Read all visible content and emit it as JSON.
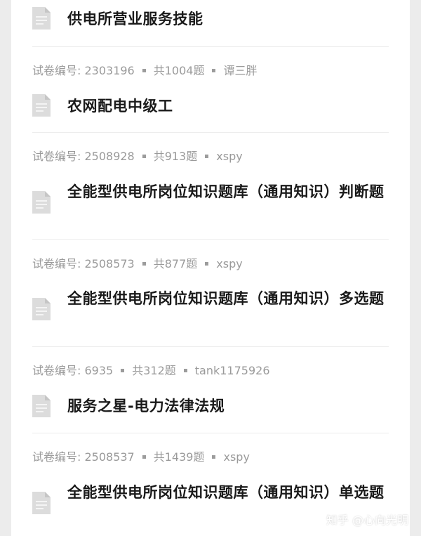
{
  "items": [
    {
      "meta": null,
      "title": "供电所营业服务技能"
    },
    {
      "meta": {
        "id": "试卷编号: 2303196",
        "count": "共1004题",
        "author": "谭三胖"
      },
      "title": "农网配电中级工"
    },
    {
      "meta": {
        "id": "试卷编号: 2508928",
        "count": "共913题",
        "author": "xspy"
      },
      "title": "全能型供电所岗位知识题库（通用知识）判断题"
    },
    {
      "meta": {
        "id": "试卷编号: 2508573",
        "count": "共877题",
        "author": "xspy"
      },
      "title": "全能型供电所岗位知识题库（通用知识）多选题"
    },
    {
      "meta": {
        "id": "试卷编号: 6935",
        "count": "共312题",
        "author": "tank1175926"
      },
      "title": "服务之星-电力法律法规"
    },
    {
      "meta": {
        "id": "试卷编号: 2508537",
        "count": "共1439题",
        "author": "xspy"
      },
      "title": "全能型供电所岗位知识题库（通用知识）单选题"
    }
  ],
  "icons": {
    "document": "document-icon",
    "separator": "square-dot-icon"
  },
  "colors": {
    "meta_text": "#9a9a9a",
    "title_text": "#1a1a1a",
    "icon": "#dcdcdc"
  },
  "watermark": "知乎 @心向光明"
}
